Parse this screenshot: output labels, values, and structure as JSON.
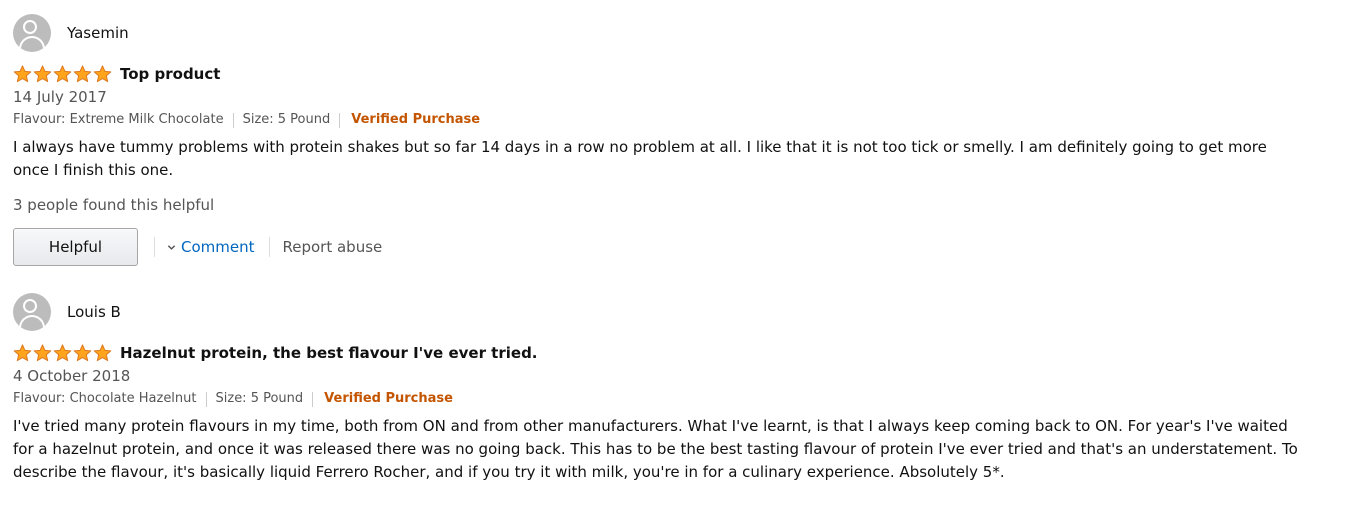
{
  "reviews": [
    {
      "author": "Yasemin",
      "rating": 5,
      "title": "Top product",
      "date": "14 July 2017",
      "flavour": "Flavour: Extreme Milk Chocolate",
      "size": "Size: 5 Pound",
      "verified": "Verified Purchase",
      "text": "I always have tummy problems with protein shakes but so far 14 days in a row no problem at all. I like that it is not too tick or smelly. I am definitely going to get more once I finish this one.",
      "helpful_count": "3 people found this helpful",
      "helpful_label": "Helpful",
      "comment_label": "Comment",
      "report_label": "Report abuse"
    },
    {
      "author": "Louis B",
      "rating": 5,
      "title": "Hazelnut protein, the best flavour I've ever tried.",
      "date": "4 October 2018",
      "flavour": "Flavour: Chocolate Hazelnut",
      "size": "Size: 5 Pound",
      "verified": "Verified Purchase",
      "text": "I've tried many protein flavours in my time, both from ON and from other manufacturers. What I've learnt, is that I always keep coming back to ON. For year's I've waited for a hazelnut protein, and once it was released there was no going back. This has to be the best tasting flavour of protein I've ever tried and that's an understatement. To describe the flavour, it's basically liquid Ferrero Rocher, and if you try it with milk, you're in for a culinary experience. Absolutely 5*."
    }
  ],
  "colors": {
    "star_fill": "#ffa41c",
    "star_stroke": "#de7921",
    "verified": "#c45500",
    "link": "#0066c0"
  }
}
